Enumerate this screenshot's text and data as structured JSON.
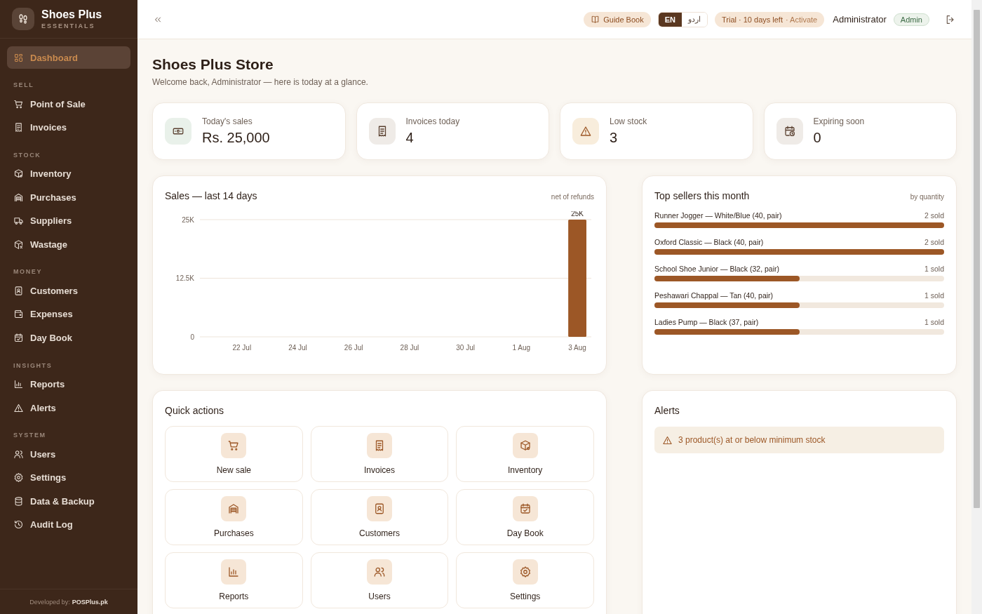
{
  "sidebar": {
    "brand": {
      "title": "Shoes Plus",
      "subtitle": "ESSENTIALS"
    },
    "sections": [
      {
        "items": [
          {
            "label": "Dashboard",
            "selected": true
          }
        ]
      },
      {
        "heading": "SELL",
        "items": [
          {
            "label": "Point of Sale",
            "selected": false
          },
          {
            "label": "Invoices",
            "selected": false
          }
        ]
      },
      {
        "heading": "STOCK",
        "items": [
          {
            "label": "Inventory",
            "selected": false
          },
          {
            "label": "Purchases",
            "selected": false
          },
          {
            "label": "Suppliers",
            "selected": false
          },
          {
            "label": "Wastage",
            "selected": false
          }
        ]
      },
      {
        "heading": "MONEY",
        "items": [
          {
            "label": "Customers",
            "selected": false
          },
          {
            "label": "Expenses",
            "selected": false
          },
          {
            "label": "Day Book",
            "selected": false
          }
        ]
      },
      {
        "heading": "INSIGHTS",
        "items": [
          {
            "label": "Reports",
            "selected": false
          },
          {
            "label": "Alerts",
            "selected": false
          }
        ]
      },
      {
        "heading": "SYSTEM",
        "items": [
          {
            "label": "Users",
            "selected": false
          },
          {
            "label": "Settings",
            "selected": false
          },
          {
            "label": "Data & Backup",
            "selected": false
          },
          {
            "label": "Audit Log",
            "selected": false
          }
        ]
      }
    ],
    "footer": "Developed by: **POSPlus.pk**"
  },
  "topbar": {
    "guide_button": "Guide Book",
    "languages": [
      {
        "label": "EN",
        "selected": true
      },
      {
        "label": "اردو",
        "selected": false
      }
    ],
    "trial": {
      "text": "Trial · 10 days left",
      "action": "· Activate"
    },
    "user": "Administrator",
    "role": "Admin"
  },
  "page": {
    "title": "Shoes Plus Store",
    "subtitle": "Welcome back, Administrator — here is today at a glance."
  },
  "stats": [
    {
      "label": "Today's sales",
      "value": "Rs. 25,000",
      "color": "#e9f1ea"
    },
    {
      "label": "Invoices today",
      "value": "4",
      "color": "#efebe7"
    },
    {
      "label": "Low stock",
      "value": "3",
      "color": "#f8eddc"
    },
    {
      "label": "Expiring soon",
      "value": "0",
      "color": "#efebe7"
    }
  ],
  "sales_chart": {
    "title": "Sales — last 14 days",
    "note": "net of refunds",
    "chart_data": {
      "type": "bar",
      "categories": [
        "22 Jul",
        "24 Jul",
        "26 Jul",
        "28 Jul",
        "30 Jul",
        "1 Aug",
        "3 Aug"
      ],
      "values": [
        0,
        0,
        0,
        0,
        0,
        0,
        25000
      ],
      "value_labels": [
        null,
        null,
        null,
        null,
        null,
        null,
        "25K"
      ],
      "ylim": [
        0,
        25000
      ],
      "yticks": [
        {
          "value": 0,
          "label": "0"
        },
        {
          "value": 12500,
          "label": "12.5K"
        },
        {
          "value": 25000,
          "label": "25K"
        }
      ]
    }
  },
  "top_sellers": {
    "title": "Top sellers this month",
    "note": "by quantity",
    "items": [
      {
        "name": "Runner Jogger — White/Blue (40, pair)",
        "count": "2 sold",
        "level": 1
      },
      {
        "name": "Oxford Classic — Black (40, pair)",
        "count": "2 sold",
        "level": 1
      },
      {
        "name": "School Shoe Junior — Black (32, pair)",
        "count": "1 sold",
        "level": 0.5
      },
      {
        "name": "Peshawari Chappal — Tan (40, pair)",
        "count": "1 sold",
        "level": 0.5
      },
      {
        "name": "Ladies Pump — Black (37, pair)",
        "count": "1 sold",
        "level": 0.5
      }
    ]
  },
  "quick_actions": {
    "title": "Quick actions",
    "items": [
      "New sale",
      "Invoices",
      "Inventory",
      "Purchases",
      "Customers",
      "Day Book",
      "Reports",
      "Users",
      "Settings"
    ]
  },
  "alerts": {
    "title": "Alerts",
    "items": [
      "3 product(s) at or below minimum stock"
    ]
  }
}
